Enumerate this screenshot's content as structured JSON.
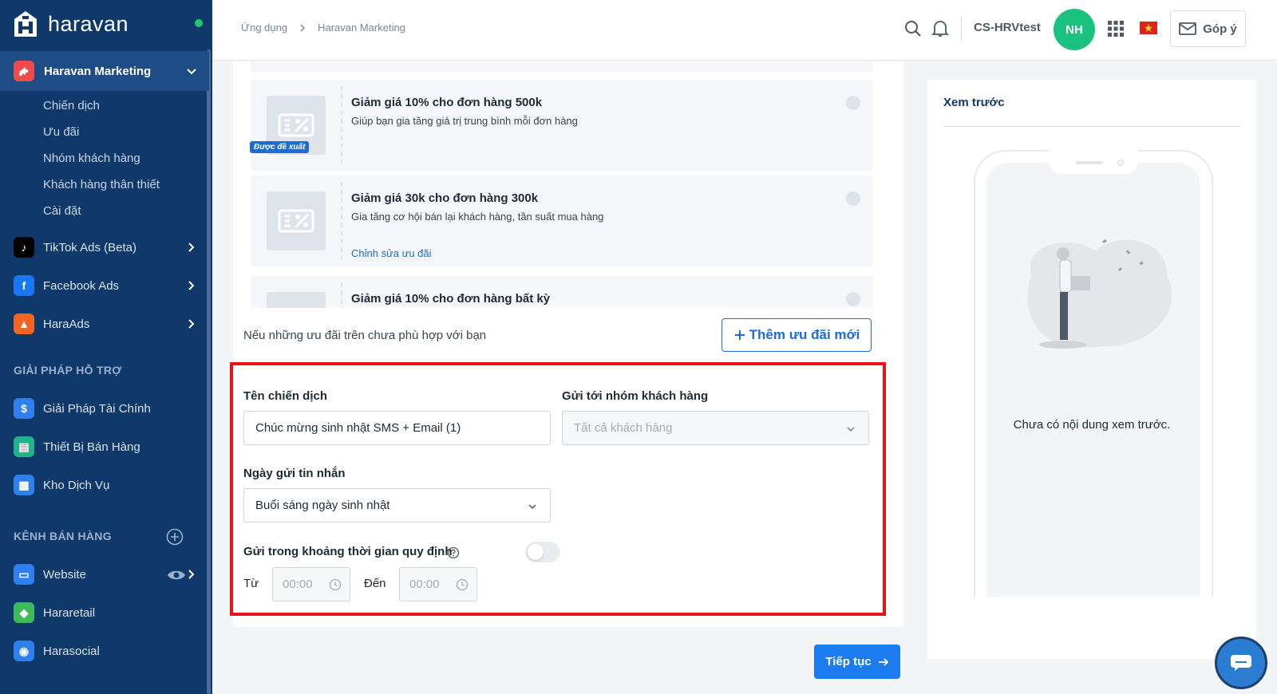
{
  "brand": {
    "name": "haravan"
  },
  "sidebar": {
    "active_app": {
      "label": "Haravan Marketing"
    },
    "sub_items": [
      {
        "label": "Chiến dịch"
      },
      {
        "label": "Ưu đãi"
      },
      {
        "label": "Nhóm khách hàng"
      },
      {
        "label": "Khách hàng thân thiết"
      },
      {
        "label": "Cài đặt"
      }
    ],
    "apps": [
      {
        "label": "TikTok Ads (Beta)",
        "icon": "tiktok-icon",
        "color": "#000000"
      },
      {
        "label": "Facebook Ads",
        "icon": "facebook-icon",
        "color": "#1877f2"
      },
      {
        "label": "HaraAds",
        "icon": "haraads-icon",
        "color": "#f26522"
      }
    ],
    "support_section": {
      "title": "GIẢI PHÁP HỖ TRỢ",
      "items": [
        {
          "label": "Giải Pháp Tài Chính",
          "icon": "finance-icon",
          "color": "#2f80ed"
        },
        {
          "label": "Thiết Bị Bán Hàng",
          "icon": "device-icon",
          "color": "#20b38a"
        },
        {
          "label": "Kho Dịch Vụ",
          "icon": "service-icon",
          "color": "#2f80ed"
        }
      ]
    },
    "channel_section": {
      "title": "KÊNH BÁN HÀNG",
      "items": [
        {
          "label": "Website",
          "icon": "website-icon",
          "color": "#2f80ed"
        },
        {
          "label": "Hararetail",
          "icon": "hararetail-icon",
          "color": "#3dbb5b"
        },
        {
          "label": "Harasocial",
          "icon": "harasocial-icon",
          "color": "#2f80ed"
        }
      ]
    }
  },
  "topbar": {
    "breadcrumb": [
      "Ứng dụng",
      "Haravan Marketing"
    ],
    "store_name": "CS-HRVtest",
    "avatar_initials": "NH",
    "feedback_label": "Góp ý"
  },
  "offers": {
    "badge": "Được đề xuất",
    "items": [
      {
        "title": "Giảm giá 10% cho đơn hàng 500k",
        "desc": "Giúp bạn gia tăng giá trị trung bình mỗi đơn hàng",
        "edit": ""
      },
      {
        "title": "Giảm giá 30k cho đơn hàng 300k",
        "desc": "Gia tăng cơ hội bán lại khách hàng, tần suất mua hàng",
        "edit": "Chỉnh sửa ưu đãi"
      },
      {
        "title": "Giảm giá 10% cho đơn hàng bất kỳ",
        "desc": "",
        "edit": ""
      }
    ],
    "hint": "Nếu những ưu đãi trên chưa phù hợp với bạn",
    "add_button": "Thêm ưu đãi mới"
  },
  "form": {
    "campaign_name_label": "Tên chiến dịch",
    "campaign_name_value": "Chúc mừng sinh nhật SMS + Email (1)",
    "group_label": "Gửi tới nhóm khách hàng",
    "group_value": "Tất cả khách hàng",
    "send_date_label": "Ngày gửi tin nhắn",
    "send_date_value": "Buổi sáng ngày sinh nhật",
    "time_window_label": "Gửi trong khoảng thời gian quy định",
    "time_window_enabled": false,
    "from_label": "Từ",
    "from_value": "00:00",
    "to_label": "Đến",
    "to_value": "00:00"
  },
  "actions": {
    "continue_label": "Tiếp tục"
  },
  "preview": {
    "title": "Xem trước",
    "empty_text": "Chưa có nội dung xem trước."
  },
  "colors": {
    "primary": "#1d6bd8",
    "sidebar": "#10396b",
    "highlight": "#e8121b",
    "avatar": "#1bc17e"
  }
}
